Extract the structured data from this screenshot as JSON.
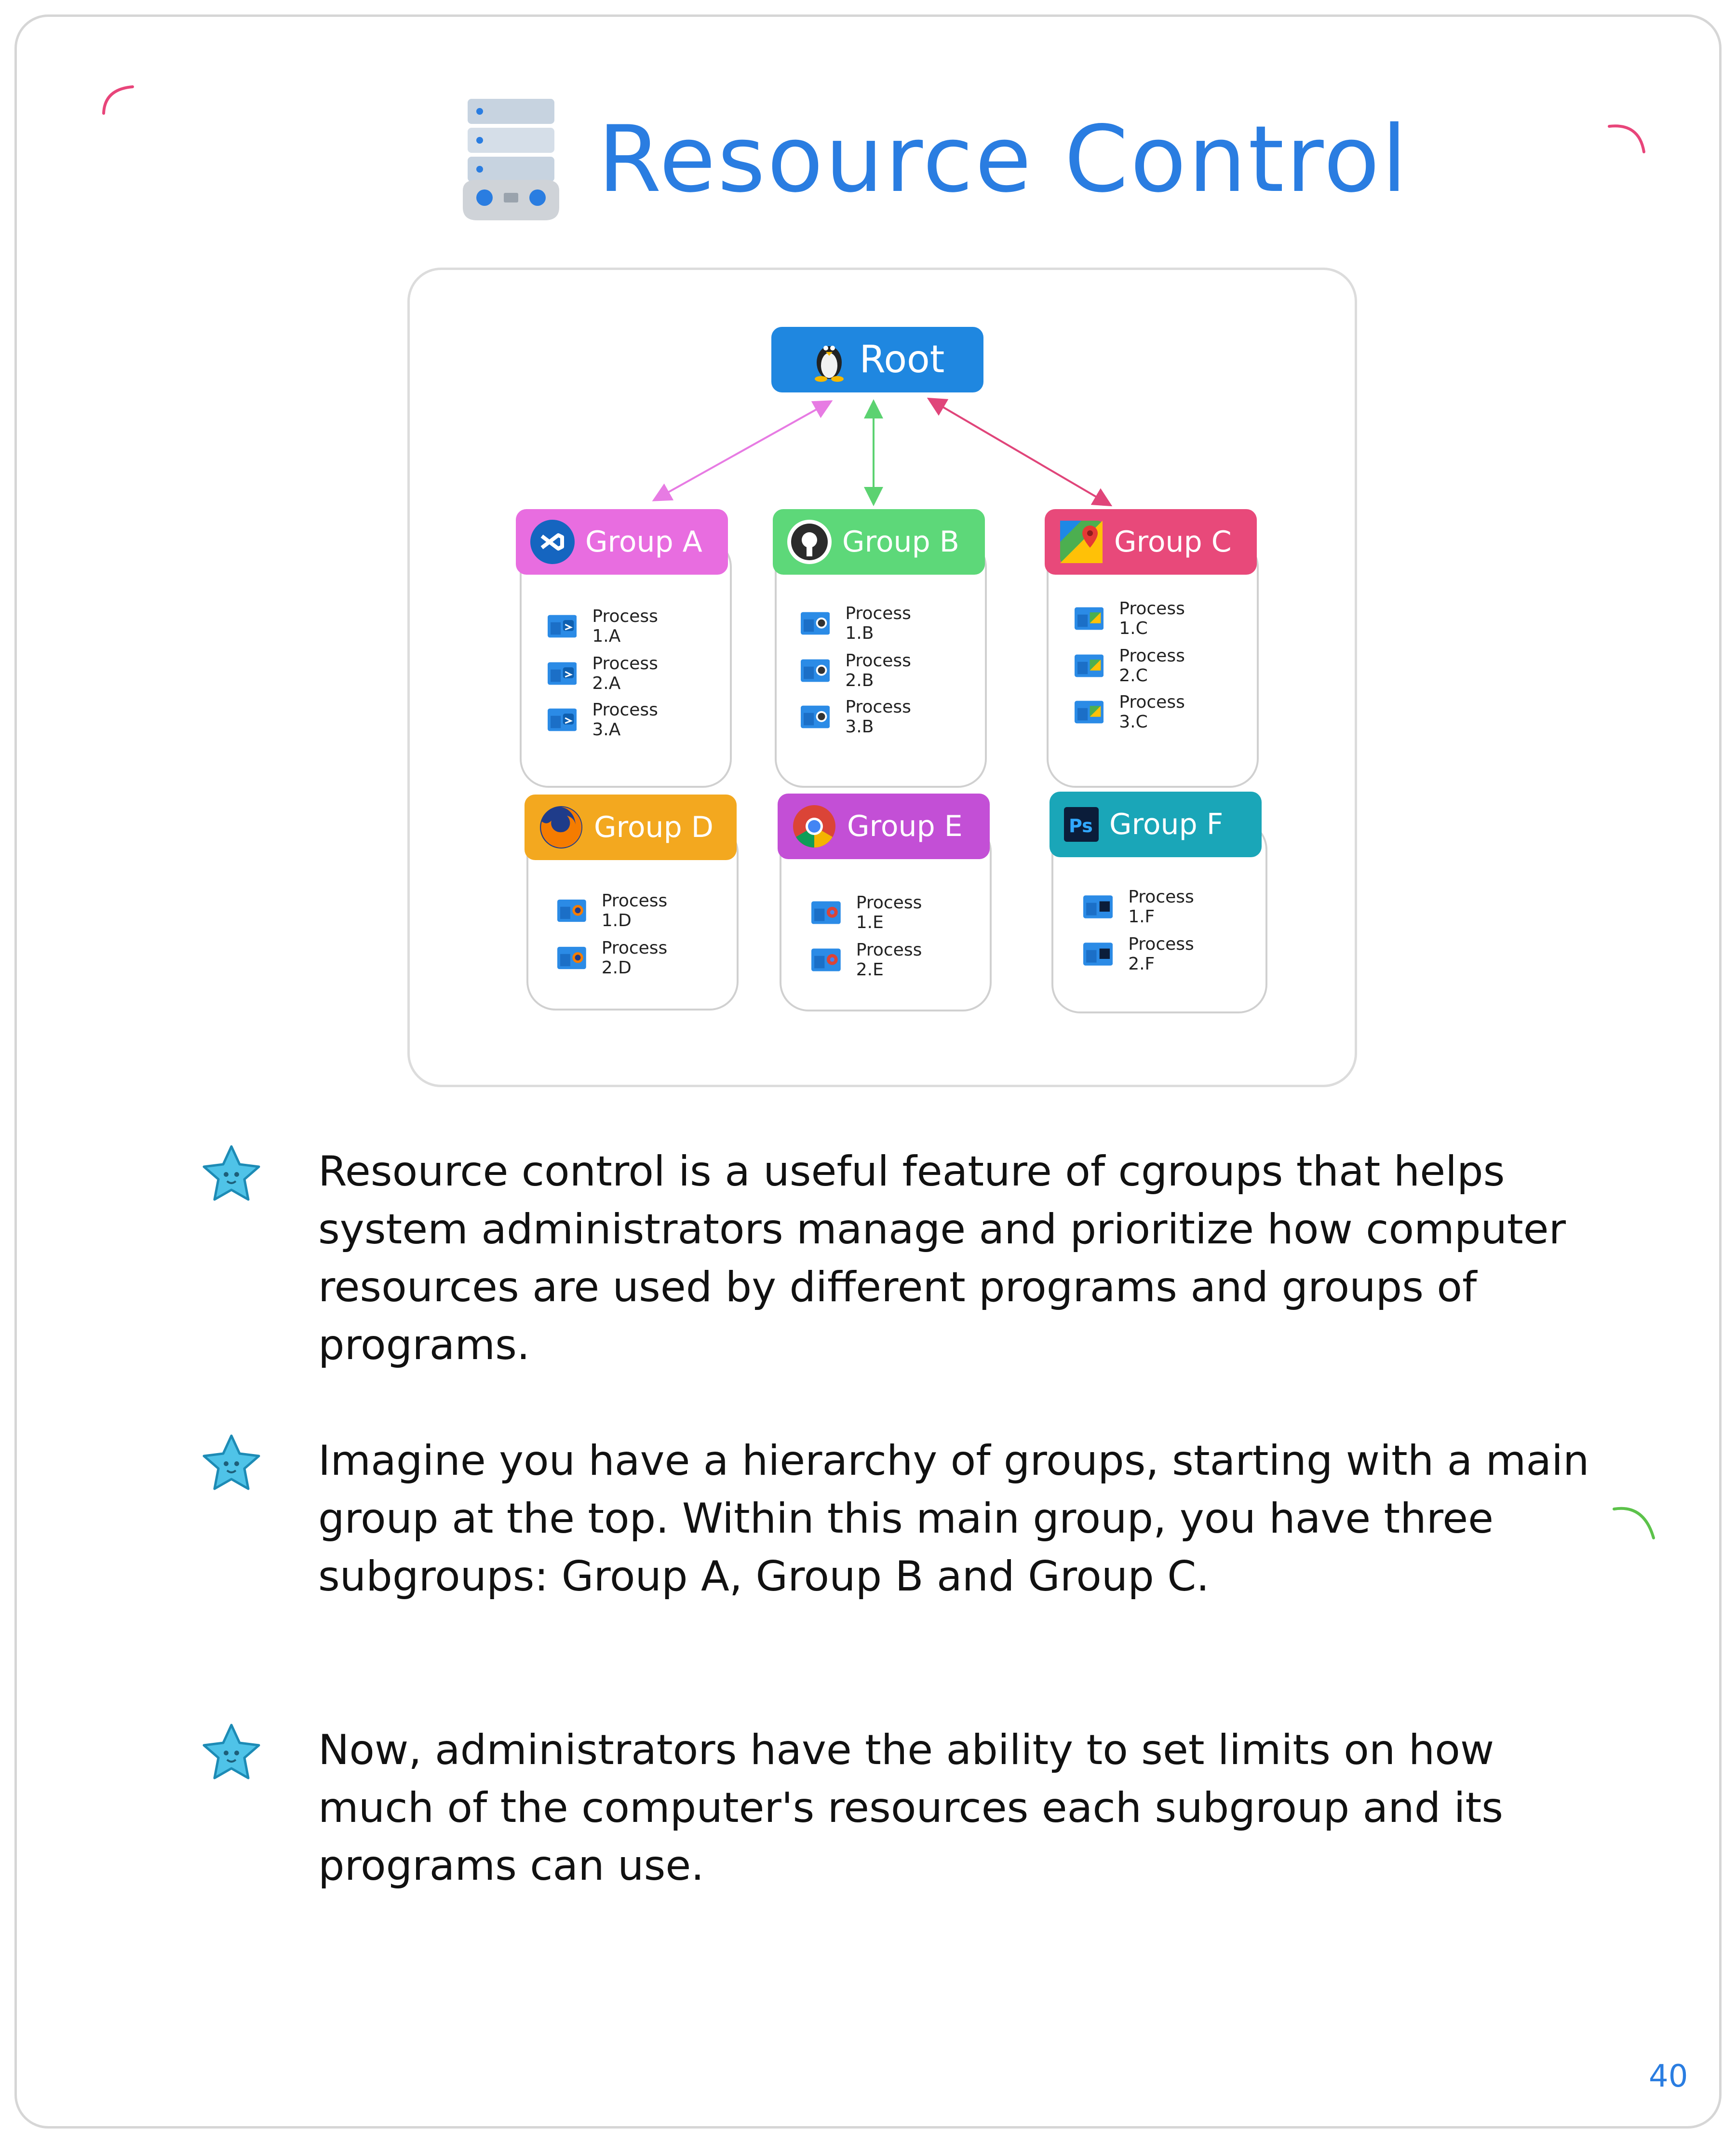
{
  "page": {
    "title": "Resource Control",
    "page_number": "40"
  },
  "diagram": {
    "root": {
      "label": "Root",
      "icon": "linux-tux-icon",
      "color": "#1f87e0"
    },
    "groups": [
      {
        "id": "a",
        "label": "Group A",
        "icon": "vscode-icon",
        "color": "#e86de0",
        "arrow_color": "#e77be3",
        "processes": [
          "Process 1.A",
          "Process 2.A",
          "Process 3.A"
        ]
      },
      {
        "id": "b",
        "label": "Group B",
        "icon": "github-icon",
        "color": "#5dd879",
        "arrow_color": "#5cd271",
        "processes": [
          "Process 1.B",
          "Process 2.B",
          "Process 3.B"
        ]
      },
      {
        "id": "c",
        "label": "Group C",
        "icon": "google-maps-icon",
        "color": "#e8497a",
        "arrow_color": "#e0457a",
        "processes": [
          "Process 1.C",
          "Process 2.C",
          "Process 3.C"
        ]
      },
      {
        "id": "d",
        "label": "Group D",
        "icon": "firefox-icon",
        "color": "#f3a81f",
        "processes": [
          "Process 1.D",
          "Process 2.D"
        ]
      },
      {
        "id": "e",
        "label": "Group E",
        "icon": "chrome-icon",
        "color": "#c34fd6",
        "processes": [
          "Process 1.E",
          "Process 2.E"
        ]
      },
      {
        "id": "f",
        "label": "Group F",
        "icon": "photoshop-icon",
        "color": "#1aa6b8",
        "processes": [
          "Process 1.F",
          "Process 2.F"
        ]
      }
    ]
  },
  "bullets": [
    "Resource control is a useful feature of cgroups that helps system administrators manage and prioritize how computer resources are used by different programs and groups of programs.",
    "Imagine you have a hierarchy of groups, starting with a main group at the top. Within this main group, you have three subgroups: Group A, Group B and Group C.",
    "Now, administrators have the ability to set limits on how much of the computer's resources each subgroup and its programs can use."
  ]
}
